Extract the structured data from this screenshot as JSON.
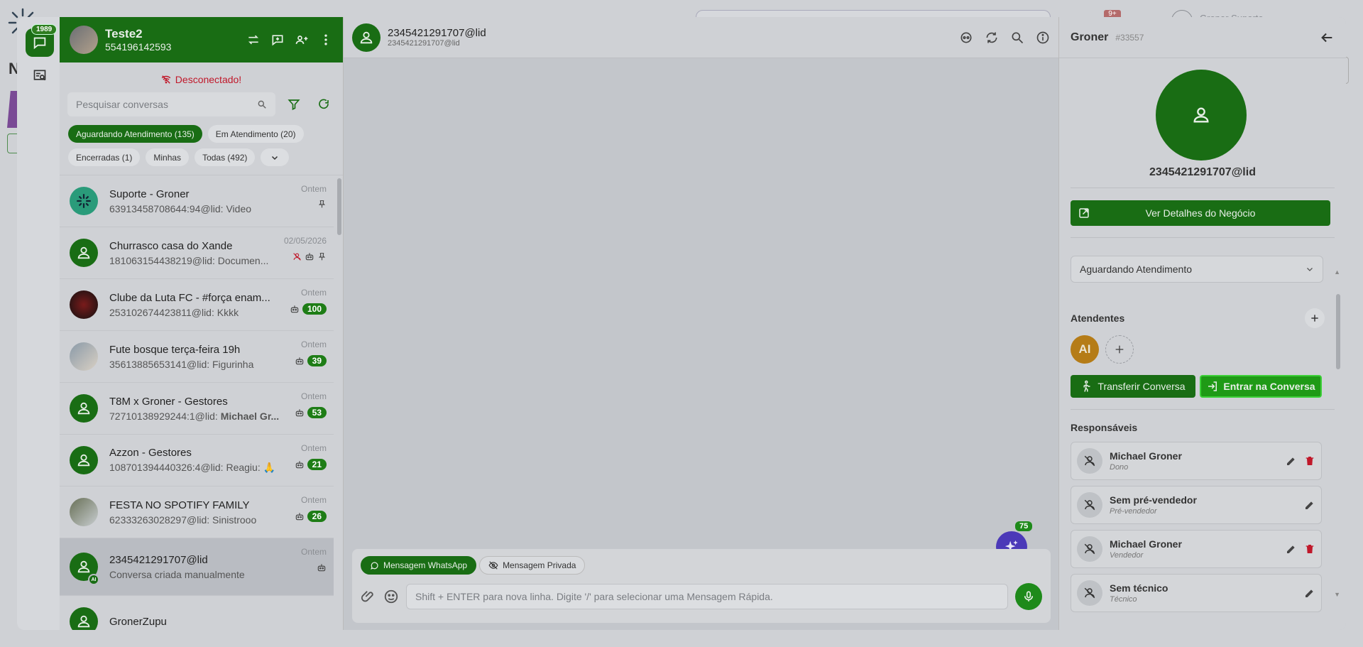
{
  "background": {
    "notification_count": "9+",
    "username": "Groner Suporte",
    "page_letter": "N"
  },
  "rail": {
    "chat_badge": "1989"
  },
  "account": {
    "name": "Teste2",
    "phone": "554196142593"
  },
  "connection": {
    "status": "Desconectado!"
  },
  "search": {
    "placeholder": "Pesquisar conversas"
  },
  "filters": [
    {
      "label": "Aguardando Atendimento (135)",
      "active": true
    },
    {
      "label": "Em Atendimento (20)",
      "active": false
    },
    {
      "label": "Encerradas (1)",
      "active": false
    },
    {
      "label": "Minhas",
      "active": false
    },
    {
      "label": "Todas (492)",
      "active": false
    }
  ],
  "conversations": [
    {
      "name": "Suporte - Groner",
      "message": "63913458708644:94@lid: Video",
      "time": "Ontem",
      "avatar": "suporte",
      "pinned": true
    },
    {
      "name": "Churrasco casa do Xande",
      "message": "181063154438219@lid: Documen...",
      "time": "02/05/2026",
      "avatar": "default",
      "pinned": true
    },
    {
      "name": "Clube da Luta FC - #força enam...",
      "message": "253102674423811@lid: Kkkk",
      "time": "Ontem",
      "avatar": "dark",
      "count": "100"
    },
    {
      "name": "Fute bosque terça-feira 19h",
      "message": "35613885653141@lid: Figurinha",
      "time": "Ontem",
      "avatar": "people",
      "count": "39"
    },
    {
      "name": "T8M x Groner - Gestores",
      "message": "72710138929244:1@lid:",
      "message_bold": "Michael Gr...",
      "time": "Ontem",
      "avatar": "default",
      "count": "53"
    },
    {
      "name": "Azzon - Gestores",
      "message": "108701394440326:4@lid: Reagiu: 🙏",
      "time": "Ontem",
      "avatar": "default",
      "count": "21"
    },
    {
      "name": "FESTA NO SPOTIFY FAMILY",
      "message": "62333263028297@lid: Sinistrooo",
      "time": "Ontem",
      "avatar": "spotify",
      "count": "26"
    },
    {
      "name": "2345421291707@lid",
      "message": "Conversa criada manualmente",
      "time": "Ontem",
      "avatar": "default",
      "selected": true,
      "ai": "AI"
    },
    {
      "name": "GronerZupu",
      "message": "",
      "time": "",
      "avatar": "default"
    }
  ],
  "chat": {
    "title": "2345421291707@lid",
    "subtitle": "2345421291707@lid",
    "ai_badge": "75",
    "tab_whatsapp": "Mensagem WhatsApp",
    "tab_private": "Mensagem Privada",
    "input_placeholder": "Shift + ENTER para nova linha. Digite '/' para selecionar uma Mensagem Rápida."
  },
  "details": {
    "name": "Groner",
    "id": "#33557",
    "lid": "2345421291707@lid",
    "deal_button": "Ver Detalhes do Negócio",
    "status": "Aguardando Atendimento",
    "attendants_title": "Atendentes",
    "attendant_initials": "AI",
    "transfer_button": "Transferir Conversa",
    "enter_button": "Entrar na Conversa",
    "responsibles_title": "Responsáveis",
    "responsibles": [
      {
        "name": "Michael Groner",
        "role": "Dono",
        "deletable": true
      },
      {
        "name": "Sem pré-vendedor",
        "role": "Pré-vendedor",
        "deletable": false
      },
      {
        "name": "Michael Groner",
        "role": "Vendedor",
        "deletable": true
      },
      {
        "name": "Sem técnico",
        "role": "Técnico",
        "deletable": false
      }
    ]
  },
  "colors": {
    "brand_green": "#196d14",
    "accent_green": "#1f9a16",
    "ai_purple": "#4b39b8",
    "danger": "#c0182a"
  }
}
